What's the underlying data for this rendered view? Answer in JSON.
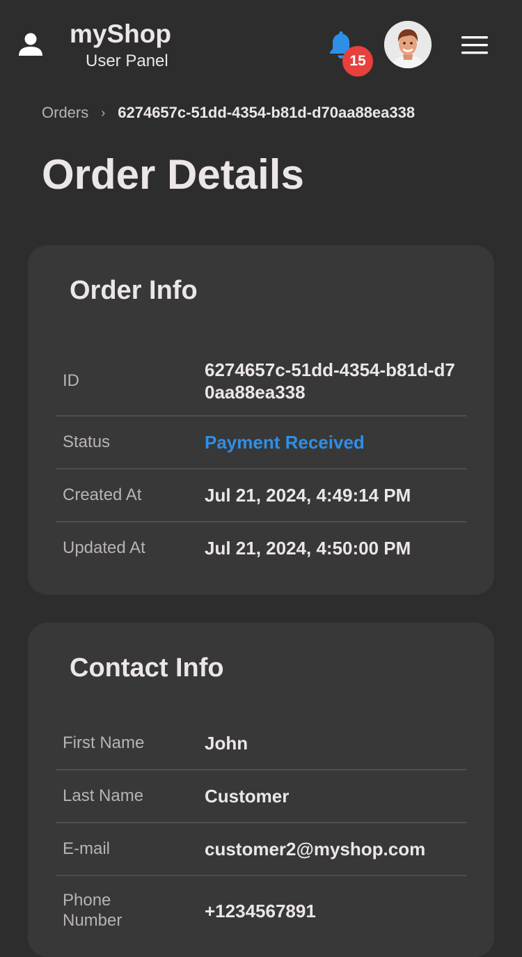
{
  "header": {
    "brand_title": "myShop",
    "brand_subtitle": "User Panel",
    "notification_count": "15",
    "icons": [
      "user-icon",
      "bell-icon",
      "avatar",
      "menu-icon"
    ]
  },
  "breadcrumb": {
    "parent": "Orders",
    "separator": "›",
    "current": "6274657c-51dd-4354-b81d-d70aa88ea338"
  },
  "page_title": "Order Details",
  "order_info": {
    "title": "Order Info",
    "rows": [
      {
        "label": "ID",
        "value": "6274657c-51dd-4354-b81d-d70aa88ea338"
      },
      {
        "label": "Status",
        "value": "Payment Received"
      },
      {
        "label": "Created At",
        "value": "Jul 21, 2024, 4:49:14 PM"
      },
      {
        "label": "Updated At",
        "value": "Jul 21, 2024, 4:50:00 PM"
      }
    ]
  },
  "contact_info": {
    "title": "Contact Info",
    "rows": [
      {
        "label": "First Name",
        "value": "John"
      },
      {
        "label": "Last Name",
        "value": "Customer"
      },
      {
        "label": "E-mail",
        "value": "customer2@myshop.com"
      },
      {
        "label": "Phone Number",
        "value": "+1234567891"
      }
    ]
  },
  "colors": {
    "background": "#2d2d2d",
    "card": "#383838",
    "status_accent": "#2e8fe6",
    "badge": "#e8403c",
    "bell": "#2e8fe6"
  }
}
